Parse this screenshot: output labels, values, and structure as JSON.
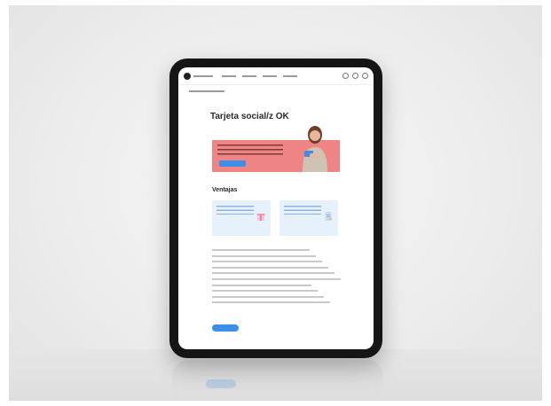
{
  "header": {
    "brand": "",
    "nav": [
      "",
      "",
      "",
      ""
    ],
    "active_nav_index": 0
  },
  "breadcrumb": "",
  "page": {
    "title": "Tarjeta social/z OK"
  },
  "banner": {
    "text": "",
    "button_label": "",
    "color": "#ee8584",
    "button_color": "#3d8ee6"
  },
  "section": {
    "title": "Ventajas"
  },
  "cards": [
    {
      "text": "",
      "icon": "gift-icon"
    },
    {
      "text": "",
      "icon": "document-icon"
    }
  ],
  "list_items": [
    "",
    "",
    "",
    "",
    "",
    "",
    "",
    "",
    "",
    ""
  ],
  "more_button": {
    "label": ""
  },
  "colors": {
    "accent": "#3d8ee6",
    "card_bg": "#e7f1fb",
    "bezel": "#151515"
  }
}
